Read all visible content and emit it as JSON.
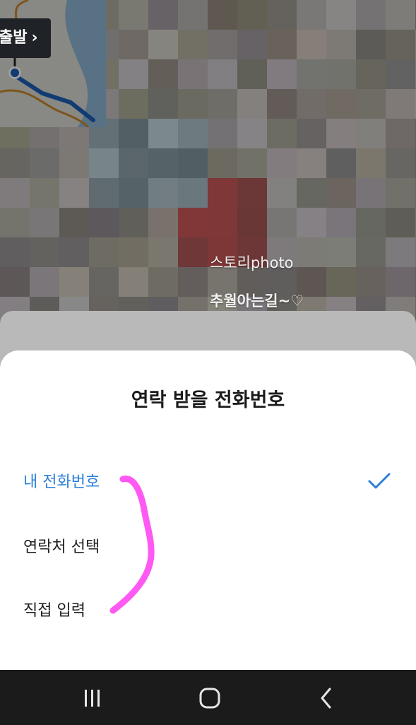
{
  "map": {
    "depart_label": "출발",
    "depart_chevron": "›"
  },
  "photo": {
    "caption_line1": "스토리photo",
    "caption_line2": "추월아는길~♡"
  },
  "help_icon": "question-circle-icon",
  "sheet": {
    "title": "연락 받을 전화번호",
    "options": [
      {
        "label": "내 전화번호",
        "selected": true
      },
      {
        "label": "연락처 선택",
        "selected": false
      },
      {
        "label": "직접 입력",
        "selected": false
      }
    ],
    "selected_color": "#2d7fd8",
    "annotation_color": "#ff3cf2"
  },
  "navbar": {
    "buttons": [
      "recents-icon",
      "home-icon",
      "back-icon"
    ]
  }
}
